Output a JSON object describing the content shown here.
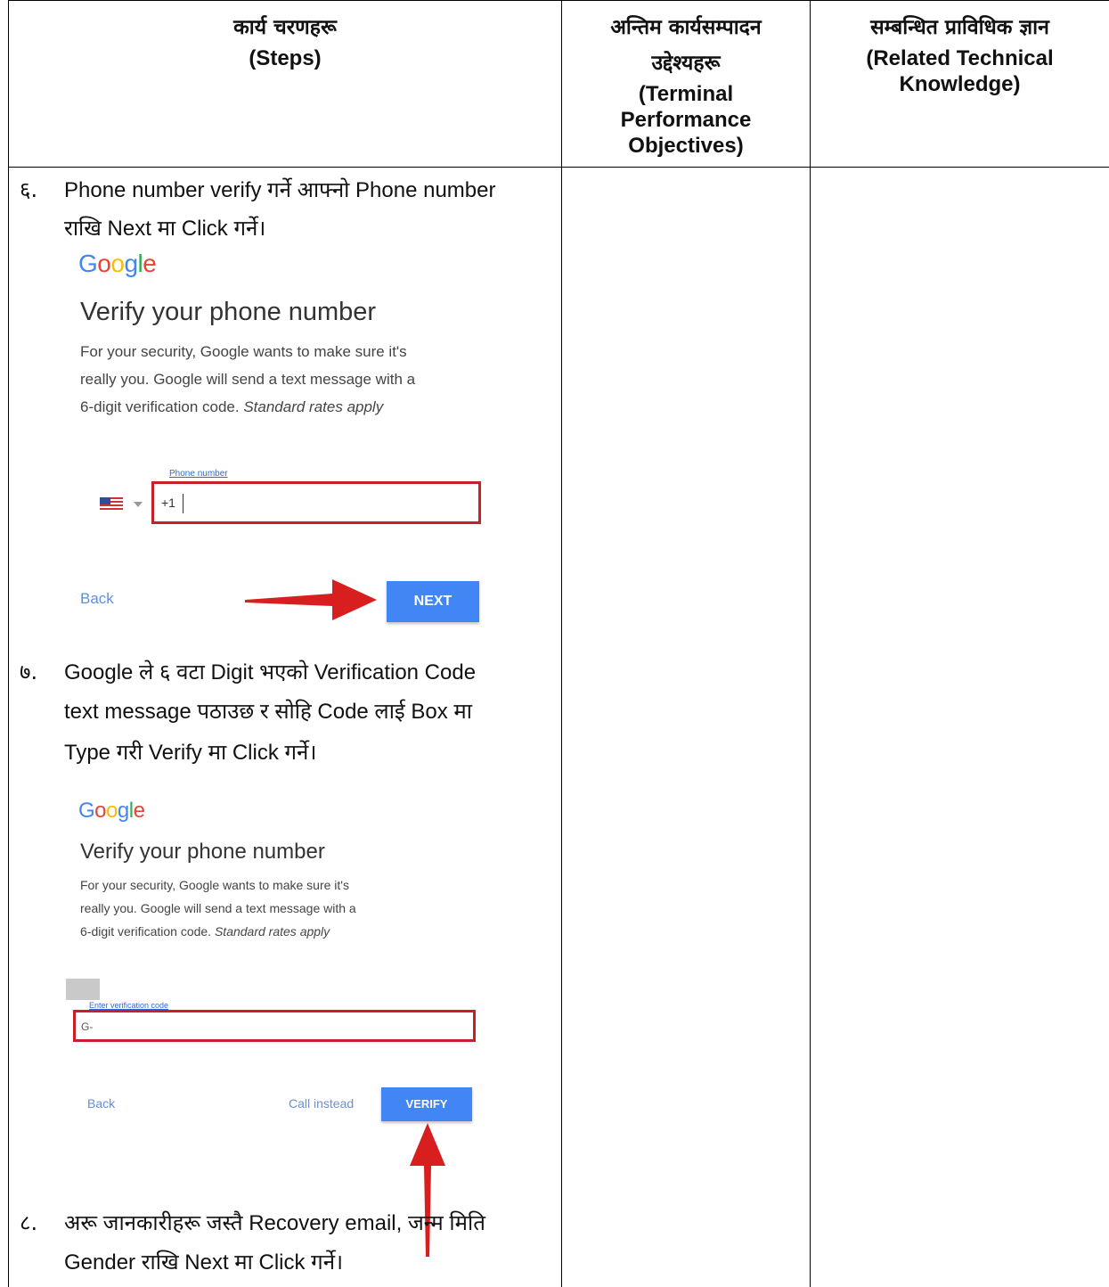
{
  "header": {
    "col1_np": "कार्य चरणहरू",
    "col1_en": "(Steps)",
    "col2_np_1": "अन्तिम कार्यसम्पादन",
    "col2_np_2": "उद्देश्यहरू",
    "col2_en_1": "(Terminal",
    "col2_en_2": "Performance",
    "col2_en_3": "Objectives)",
    "col3_np": "सम्बन्धित प्राविधिक ज्ञान",
    "col3_en_1": "(Related Technical",
    "col3_en_2": "Knowledge)"
  },
  "steps": {
    "s6": {
      "num": "६.",
      "line1": "Phone number verify गर्ने आफ्नो Phone number",
      "line2": "राखि Next मा Click गर्ने।"
    },
    "s7": {
      "num": "७.",
      "line1": "Google ले ६ वटा Digit भएको Verification Code",
      "line2": "text message पठाउछ र सोहि Code लाई Box मा",
      "line3": "Type गरी Verify मा Click   गर्ने।"
    },
    "s8": {
      "num": "८.",
      "line1": "अरू जानकारीहरू जस्तै Recovery email, जन्म  मिति",
      "line2": "Gender राखि Next मा Click गर्ने।"
    }
  },
  "panel1": {
    "logo": "Google",
    "title": "Verify your phone number",
    "desc1": "For your security, Google wants to make sure it's",
    "desc2": "really you. Google will send a text message with a",
    "desc3": "6-digit verification code.",
    "desc3_italic": "Standard rates apply",
    "field_label": "Phone number",
    "field_value": "+1",
    "back_label": "Back",
    "next_label": "NEXT"
  },
  "panel2": {
    "logo": "Google",
    "title": "Verify your phone number",
    "desc1": "For your security, Google wants to make sure it's",
    "desc2": "really you. Google will send a text message with a",
    "desc3": "6-digit verification code.",
    "desc3_italic": "Standard rates apply",
    "field_label": "Enter verification code",
    "field_value": "G-",
    "back_label": "Back",
    "call_label": "Call instead",
    "verify_label": "VERIFY"
  },
  "colors": {
    "highlight_border": "#c8202b",
    "button_blue": "#4285f4",
    "arrow_red": "#d81e1e"
  },
  "icons": [
    "us-flag-icon",
    "dropdown-caret-icon",
    "red-arrow-right-icon",
    "red-arrow-up-icon"
  ]
}
